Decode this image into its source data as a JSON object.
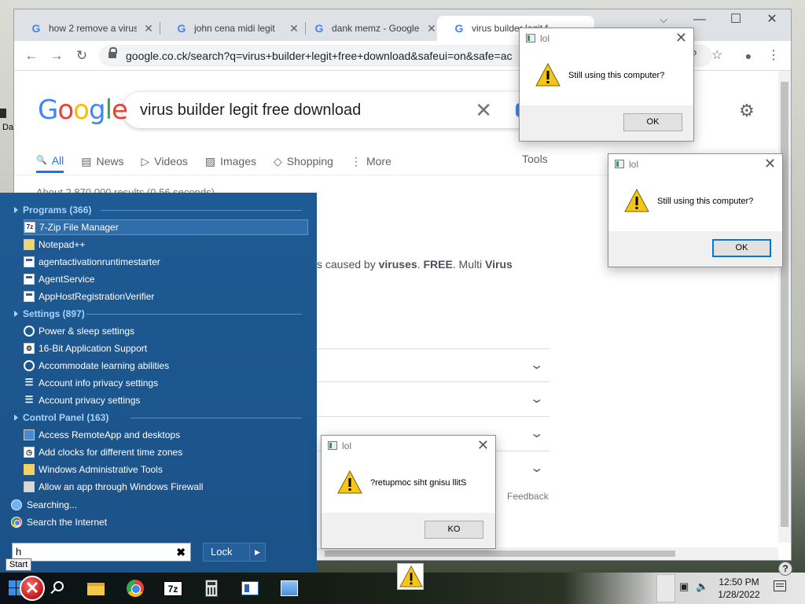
{
  "browser": {
    "tabs": [
      {
        "title": "how 2 remove a virus"
      },
      {
        "title": "john cena midi legit"
      },
      {
        "title": "dank memz - Google"
      },
      {
        "title": "virus builder legit f"
      }
    ],
    "tab_favicon": "G",
    "tab_close": "✕",
    "window_controls": {
      "minimize": "—",
      "maximize": "☐",
      "close": "✕",
      "tab_search": "⌵"
    },
    "url": "google.co.ck/search?q=virus+builder+legit+free+download&safeui=on&safe=ac",
    "icons": {
      "back": "←",
      "forward": "→",
      "reload": "↻",
      "bookmark": "☆",
      "menu": "⋮",
      "profile": "●",
      "extension": "?"
    }
  },
  "google": {
    "logo_letters": [
      "G",
      "o",
      "o",
      "g",
      "l",
      "e"
    ],
    "query": "virus builder legit free download",
    "clear": "✕",
    "settings_icon": "⚙",
    "tabs": [
      {
        "icon": "🔍",
        "label": "All"
      },
      {
        "icon": "▤",
        "label": "News"
      },
      {
        "icon": "▷",
        "label": "Videos"
      },
      {
        "icon": "▨",
        "label": "Images"
      },
      {
        "icon": "◇",
        "label": "Shopping"
      },
      {
        "icon": "⋮",
        "label": "More"
      }
    ],
    "tools": "Tools",
    "stats": "About 2,870,000 results (0.56 seconds)",
    "snippet_pre": "s caused by ",
    "snippet_b1": "viruses",
    "snippet_mid": ". ",
    "snippet_b2": "FREE",
    "snippet_post": ". Multi ",
    "snippet_b3": "Virus",
    "feedback": "Feedback",
    "chevron": "⌄"
  },
  "start_menu": {
    "sections": {
      "programs": "Programs (366)",
      "settings": "Settings (897)",
      "control_panel": "Control Panel (163)"
    },
    "programs": [
      {
        "icon": "7z",
        "label": "7-Zip File Manager"
      },
      {
        "icon": "notepad",
        "label": "Notepad++"
      },
      {
        "icon": "window",
        "label": "agentactivationruntimestarter"
      },
      {
        "icon": "window",
        "label": "AgentService"
      },
      {
        "icon": "window",
        "label": "AppHostRegistrationVerifier"
      }
    ],
    "settings": [
      {
        "icon": "power",
        "label": "Power & sleep settings"
      },
      {
        "icon": "gear",
        "label": "16-Bit Application Support"
      },
      {
        "icon": "ease",
        "label": "Accommodate learning abilities"
      },
      {
        "icon": "person",
        "label": "Account info privacy settings"
      },
      {
        "icon": "person",
        "label": "Account privacy settings"
      }
    ],
    "control_panel": [
      {
        "icon": "remote",
        "label": "Access RemoteApp and desktops"
      },
      {
        "icon": "clock",
        "label": "Add clocks for different time zones"
      },
      {
        "icon": "folder",
        "label": "Windows Administrative Tools"
      },
      {
        "icon": "firewall",
        "label": "Allow an app through Windows Firewall"
      }
    ],
    "searching": "Searching...",
    "search_internet": "Search the Internet",
    "search_value": "h",
    "clear": "✖",
    "lock_label": "Lock",
    "lock_arrow": "▶",
    "tooltip": "Start"
  },
  "dialogs": [
    {
      "title": "lol",
      "message": "Still using this computer?",
      "button": "OK"
    },
    {
      "title": "lol",
      "message": "Still using this computer?",
      "button": "OK"
    },
    {
      "title": "lol",
      "message": "?retupmoc siht gnisu llitS",
      "button": "KO"
    }
  ],
  "dialog_close": "✕",
  "taskbar": {
    "time": "12:50 PM",
    "date": "1/28/2022",
    "sevenzip_label": "7z",
    "red_x": "✕",
    "tray_network": "▣",
    "tray_volume": "🔈",
    "help": "?"
  },
  "desktop": {
    "partial_label": "Da"
  },
  "colors": {
    "start_menu": "#1e5a94",
    "accent": "#1a73e8",
    "section": "#a8d3ff"
  }
}
